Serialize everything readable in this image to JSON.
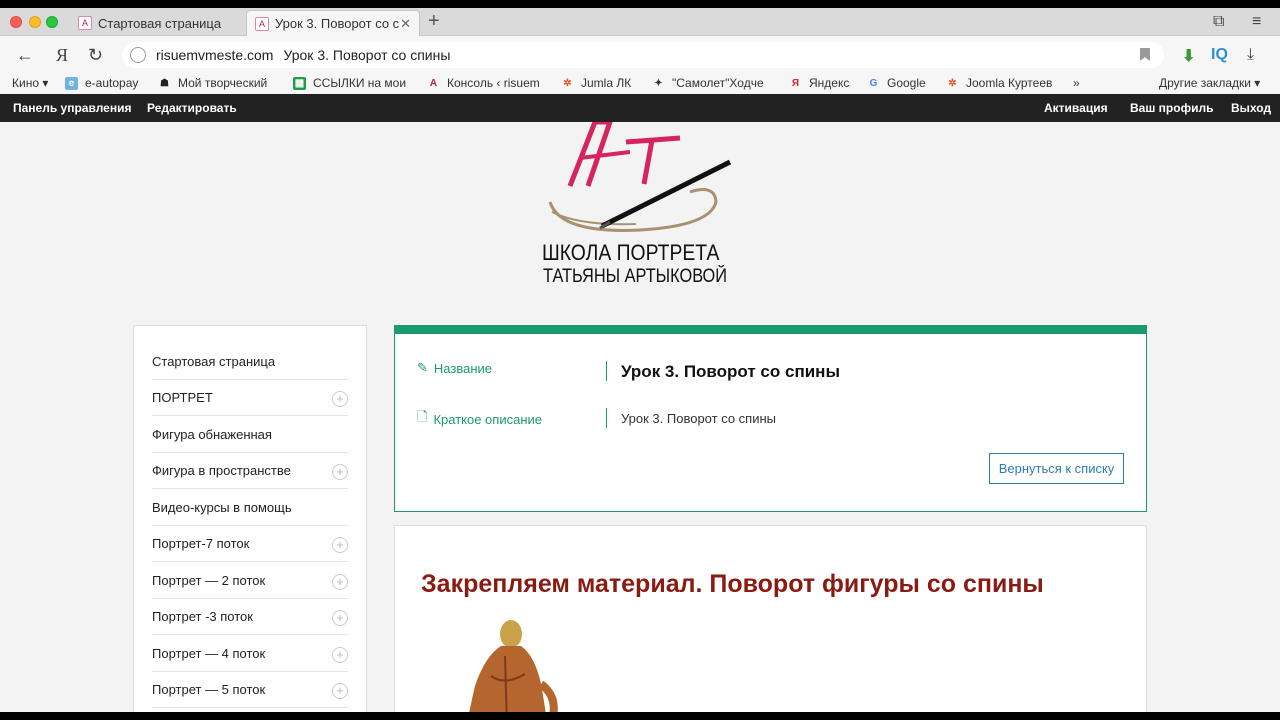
{
  "browser": {
    "tabs": [
      {
        "label": "Стартовая страница"
      },
      {
        "label": "Урок 3. Поворот со с"
      }
    ],
    "address": {
      "domain": "risuemvmeste.com",
      "page_title": "Урок 3. Поворот со спины"
    },
    "extensions": {
      "iq_label": "IQ"
    },
    "bookmarks": [
      {
        "label": "Кино ▾"
      },
      {
        "label": "e-autopay"
      },
      {
        "label": "Мой творческий"
      },
      {
        "label": "ССЫЛКИ на мои"
      },
      {
        "label": "Консоль ‹ risuem"
      },
      {
        "label": "Jumla ЛК"
      },
      {
        "label": "\"Самолет\"Ходче"
      },
      {
        "label": "Яндекс"
      },
      {
        "label": "Google"
      },
      {
        "label": "Joomla Куртеев"
      }
    ],
    "other_bookmarks": "Другие закладки ▾",
    "more_bookmarks": "»"
  },
  "adminbar": {
    "left": [
      "Панель управления",
      "Редактировать"
    ],
    "right": [
      "Активация",
      "Ваш профиль",
      "Выход"
    ]
  },
  "logo": {
    "monogram": "АТ",
    "line1": "ШКОЛА ПОРТРЕТА",
    "line2": "ТАТЬЯНЫ АРТЫКОВОЙ"
  },
  "sidebar": {
    "items": [
      {
        "label": "Стартовая страница",
        "expandable": false
      },
      {
        "label": "ПОРТРЕТ",
        "expandable": true
      },
      {
        "label": "Фигура обнаженная",
        "expandable": false
      },
      {
        "label": "Фигура в пространстве",
        "expandable": true
      },
      {
        "label": "Видео-курсы в помощь",
        "expandable": false
      },
      {
        "label": "Портрет-7 поток",
        "expandable": true
      },
      {
        "label": "Портрет — 2 поток",
        "expandable": true
      },
      {
        "label": "Портрет -3 поток",
        "expandable": true
      },
      {
        "label": "Портрет — 4 поток",
        "expandable": true
      },
      {
        "label": "Портрет — 5 поток",
        "expandable": true
      }
    ]
  },
  "lesson": {
    "name_label": "Название",
    "name_value": "Урок 3. Поворот со спины",
    "desc_label": "Краткое описание",
    "desc_value": "Урок 3. Поворот со спины",
    "back_button": "Вернуться к списку"
  },
  "content": {
    "heading": "Закрепляем материал. Поворот фигуры со спины"
  },
  "colors": {
    "accent_green": "#1a9a6e",
    "heading_red": "#8b1a12",
    "button_blue": "#2b7fb0",
    "admin_bar": "#222222"
  }
}
